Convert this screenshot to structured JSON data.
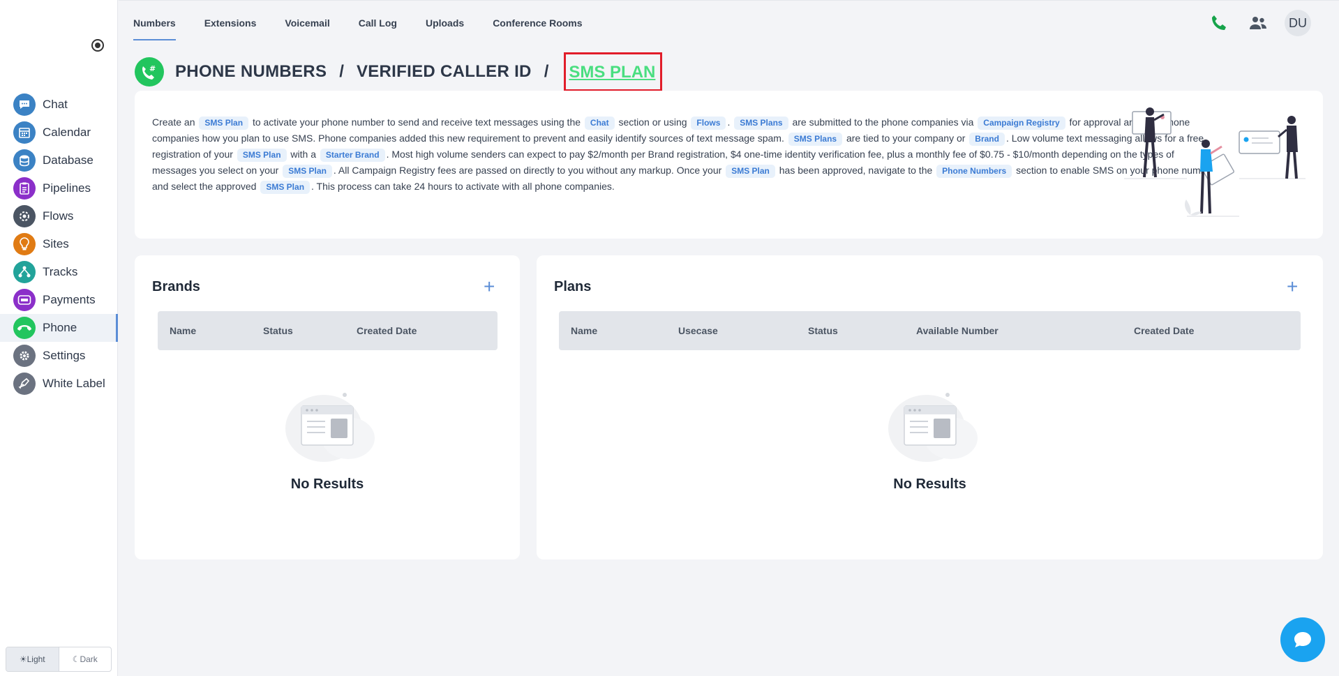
{
  "sidebar": {
    "items": [
      {
        "label": "Chat",
        "icon": "chat-icon",
        "color": "#3b82c4"
      },
      {
        "label": "Calendar",
        "icon": "calendar-icon",
        "color": "#3b82c4"
      },
      {
        "label": "Database",
        "icon": "database-icon",
        "color": "#3b82c4"
      },
      {
        "label": "Pipelines",
        "icon": "pipelines-icon",
        "color": "#8b2fc9"
      },
      {
        "label": "Flows",
        "icon": "flows-icon",
        "color": "#4b5563"
      },
      {
        "label": "Sites",
        "icon": "sites-icon",
        "color": "#e07b14"
      },
      {
        "label": "Tracks",
        "icon": "tracks-icon",
        "color": "#22a39a"
      },
      {
        "label": "Payments",
        "icon": "payments-icon",
        "color": "#8b2fc9"
      },
      {
        "label": "Phone",
        "icon": "phone-icon",
        "color": "#22c55e"
      },
      {
        "label": "Settings",
        "icon": "settings-icon",
        "color": "#6b7280"
      },
      {
        "label": "White Label",
        "icon": "white-label-icon",
        "color": "#6b7280"
      }
    ],
    "active": "Phone",
    "theme": {
      "light": "Light",
      "dark": "Dark"
    }
  },
  "topbar": {
    "tabs": [
      "Numbers",
      "Extensions",
      "Voicemail",
      "Call Log",
      "Uploads",
      "Conference Rooms"
    ],
    "active_tab": "Numbers",
    "avatar": "DU"
  },
  "heading": {
    "crumb1": "PHONE NUMBERS",
    "crumb2": "VERIFIED CALLER ID",
    "crumb3": "SMS PLAN",
    "separator": "/"
  },
  "info": {
    "t1": "Create an",
    "c1": "SMS Plan",
    "t2": "to activate your phone number to send and receive text messages using the",
    "c2": "Chat",
    "t3": "section or using",
    "c3": "Flows",
    "t4": ".",
    "c4": "SMS Plans",
    "t5": "are submitted to the phone companies via",
    "c5": "Campaign Registry",
    "t6": "for approval and tells phone companies how you plan to use SMS. Phone companies added this new requirement to prevent and easily identify sources of text message spam.",
    "c6": "SMS Plans",
    "t7": "are tied to your company or",
    "c7": "Brand",
    "t8": ". Low volume text messaging allows for a free registration of your",
    "c8": "SMS Plan",
    "t9": "with a",
    "c9": "Starter Brand",
    "t10": ". Most high volume senders can expect to pay $2/month per Brand registration, $4 one-time identity verification fee, plus a monthly fee of $0.75 - $10/month depending on the types of messages you select on your",
    "c10": "SMS Plan",
    "t11": ". All Campaign Registry fees are passed on directly to you without any markup. Once your",
    "c11": "SMS Plan",
    "t12": "has been approved, navigate to the",
    "c12": "Phone Numbers",
    "t13": "section to enable SMS on your phone number and select the approved",
    "c13": "SMS Plan",
    "t14": ". This process can take 24 hours to activate with all phone companies."
  },
  "brands": {
    "title": "Brands",
    "add": "+",
    "columns": [
      "Name",
      "Status",
      "Created Date"
    ],
    "empty": "No Results"
  },
  "plans": {
    "title": "Plans",
    "add": "+",
    "columns": [
      "Name",
      "Usecase",
      "Status",
      "Available Number",
      "Created Date"
    ],
    "empty": "No Results"
  }
}
